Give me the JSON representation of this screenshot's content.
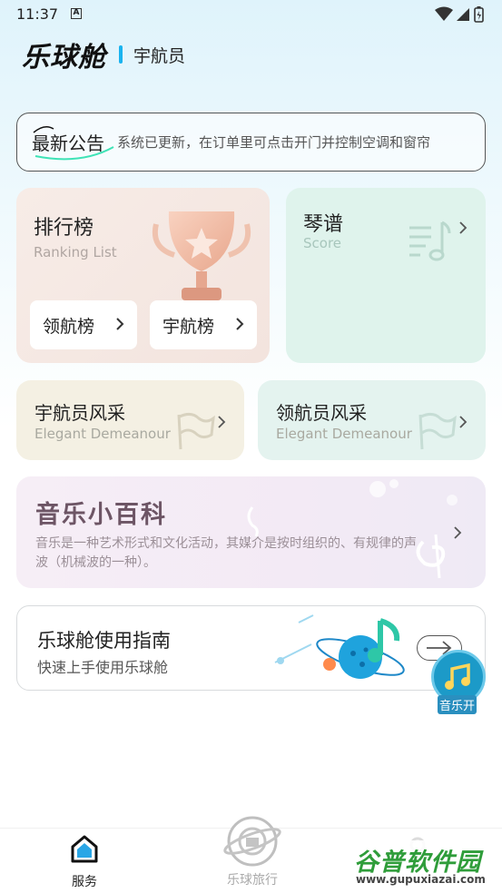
{
  "status_bar": {
    "time": "11:37",
    "notification_icon": "A"
  },
  "header": {
    "brand": "乐球舱",
    "role": "宇航员"
  },
  "notice": {
    "title": "最新公告",
    "text": "系统已更新，在订单里可点击开门并控制空调和窗帘"
  },
  "ranking": {
    "title": "排行榜",
    "subtitle": "Ranking List",
    "buttons": [
      "领航榜",
      "宇航榜"
    ]
  },
  "score": {
    "title": "琴谱",
    "subtitle": "Score"
  },
  "elegant": [
    {
      "title": "宇航员风采",
      "subtitle": "Elegant Demeanour"
    },
    {
      "title": "领航员风采",
      "subtitle": "Elegant Demeanour"
    }
  ],
  "wiki": {
    "title": "音乐小百科",
    "desc": "音乐是一种艺术形式和文化活动，其媒介是按时组织的、有规律的声波（机械波的一种）。"
  },
  "guide": {
    "title": "乐球舱使用指南",
    "subtitle": "快速上手使用乐球舱"
  },
  "music_fab": {
    "label": "音乐开"
  },
  "tabbar": {
    "items": [
      {
        "label": "服务",
        "icon": "home-icon",
        "active": true
      },
      {
        "label": "乐球旅行",
        "icon": "planet-icon",
        "active": false
      }
    ]
  },
  "watermark": {
    "main": "谷普软件园",
    "url": "www.gupuxiazai.com"
  },
  "colors": {
    "accent": "#1ab3ef",
    "wiki_title": "#6d5565",
    "watermark_green": "#2f9d3a"
  }
}
